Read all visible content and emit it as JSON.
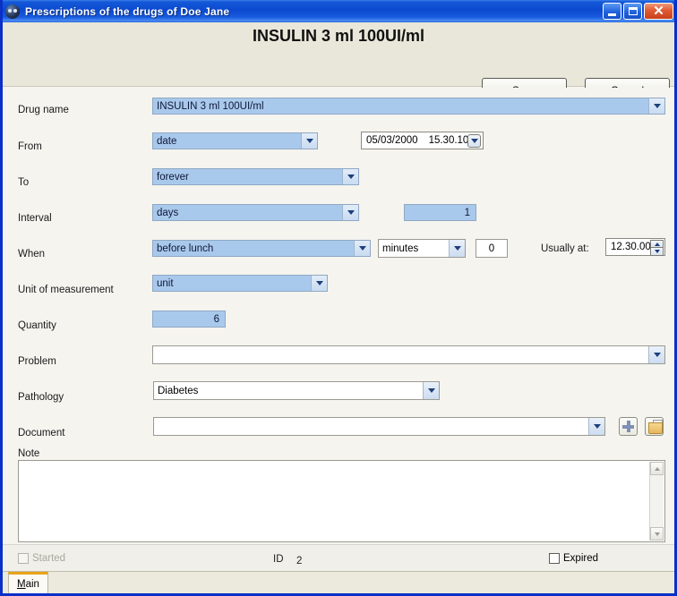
{
  "window": {
    "title": "Prescriptions of the drugs of Doe Jane",
    "icon": "app-circle-icon",
    "minimize_label": "_",
    "maximize_label": "❐",
    "close_label": "✕"
  },
  "header": {
    "title": "INSULIN 3 ml 100UI/ml",
    "save_label": "Save",
    "save_accel": "S",
    "cancel_label": "Cancel",
    "cancel_accel": "C"
  },
  "form": {
    "drug_name": {
      "label": "Drug name",
      "value": "INSULIN 3 ml 100UI/ml"
    },
    "from": {
      "label": "From",
      "mode_value": "date",
      "date_value": "05/03/2000",
      "time_value": "15.30.10"
    },
    "to": {
      "label": "To",
      "value": "forever"
    },
    "interval": {
      "label": "Interval",
      "unit_value": "days",
      "count_value": "1"
    },
    "when": {
      "label": "When",
      "value": "before lunch",
      "offset_unit": "minutes",
      "offset_value": "0",
      "usually_label": "Usually at:",
      "usually_value": "12.30.00"
    },
    "unit_of_measurement": {
      "label": "Unit of measurement",
      "value": "unit"
    },
    "quantity": {
      "label": "Quantity",
      "value": "6"
    },
    "problem": {
      "label": "Problem",
      "value": ""
    },
    "pathology": {
      "label": "Pathology",
      "value": "Diabetes"
    },
    "document": {
      "label": "Document",
      "value": "",
      "add_icon": "plus-icon",
      "browse_icon": "folder-document-icon"
    },
    "note": {
      "label": "Note",
      "value": ""
    }
  },
  "status": {
    "started_label": "Started",
    "started_checked": false,
    "started_disabled": true,
    "id_label": "ID",
    "id_value": "2",
    "expired_label": "Expired",
    "expired_checked": false
  },
  "tabs": {
    "main_label": "Main",
    "main_accel": "M"
  },
  "colors": {
    "titlebar_blue": "#0b49d0",
    "window_border": "#0a30c8",
    "header_band": "#e9e7d9",
    "form_background": "#f5f4ef",
    "field_highlight": "#a9c9ec",
    "tab_accent": "#e8a317"
  }
}
